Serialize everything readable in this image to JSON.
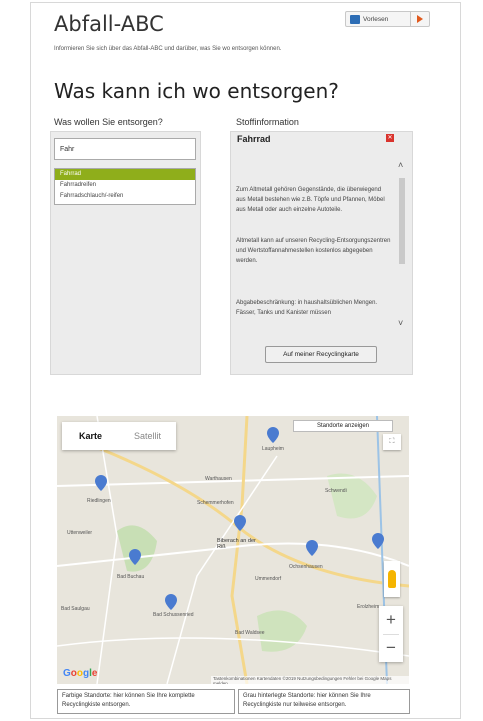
{
  "page": {
    "title": "Abfall-ABC",
    "intro": "Informieren Sie sich über das Abfall-ABC und darüber, was Sie wo entsorgen können.",
    "heading": "Was kann ich wo entsorgen?",
    "listen_button": "Vorlesen"
  },
  "search": {
    "label": "Was wollen Sie entsorgen?",
    "value": "Fahr",
    "suggestions": [
      "Fahrrad",
      "Fahrradreifen",
      "Fahrradschlauch/-reifen"
    ]
  },
  "info": {
    "label": "Stoffinformation",
    "title": "Fahrrad",
    "paragraphs": [
      "Zum Altmetall gehören Gegenstände, die überwiegend aus Metall bestehen wie z.B. Töpfe und Pfannen, Möbel aus Metall oder auch einzelne Autoteile.",
      "Altmetall kann auf unseren Recycling-Entsorgungszentren und Wertstoffannahmestellen kostenlos abgegeben werden.",
      "Abgabebeschränkung: in haushaltsüblichen Mengen. Fässer, Tanks und Kanister müssen"
    ],
    "recycling_button": "Auf meiner Recyclingkarte"
  },
  "map": {
    "tab_map": "Karte",
    "tab_satellite": "Satellit",
    "show_locations": "Standorte anzeigen",
    "zoom_in": "+",
    "zoom_out": "−",
    "logo": "Google",
    "attribution": "Tastenkombinationen   Kartendaten ©2019   Nutzungsbedingungen   Fehler bei Google Maps melden",
    "towns": [
      "Laupheim",
      "Schwendi",
      "Biberach an der Riß",
      "Bad Buchau",
      "Bad Saulgau",
      "Bad Schussenried",
      "Ochsenhausen",
      "Bad Waldsee",
      "Riedlingen",
      "Warthausen",
      "Ummendorf",
      "Schemmerhofen",
      "Uttenweiler",
      "Erolzheim"
    ]
  },
  "legend": {
    "left": "Farbige Standorte: hier können Sie Ihre komplette Recyclingkiste entsorgen.",
    "right": "Grau hinterlegte Standorte: hier können Sie Ihre Recyclingkiste nur teilweise entsorgen."
  },
  "colors": {
    "accent": "#8fae1b",
    "marker": "#4a7bd0",
    "close": "#d9332d",
    "speaker": "#2d6db5",
    "play": "#e05a1e"
  }
}
